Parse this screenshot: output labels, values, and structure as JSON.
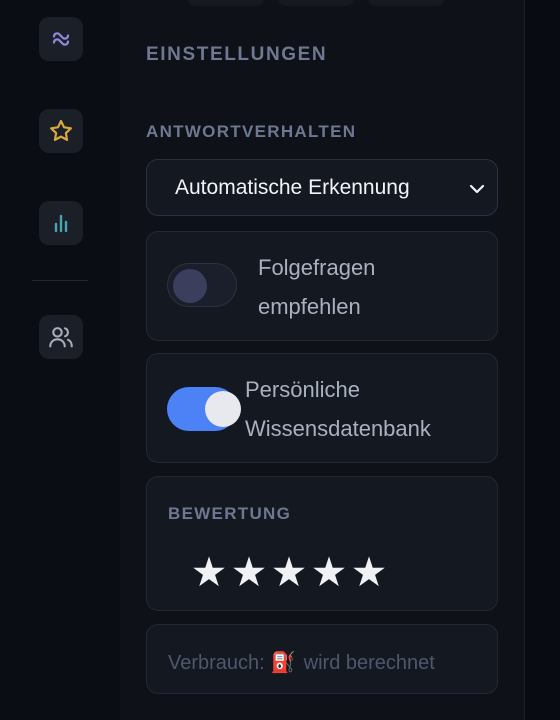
{
  "rail": {
    "items": [
      {
        "icon": "link-icon",
        "color": "#8f86d8"
      },
      {
        "icon": "star-icon",
        "color": "#d9a93c"
      },
      {
        "icon": "bar-chart-icon",
        "color": "#4aa3b0"
      },
      {
        "icon": "users-icon",
        "color": "#a7aebb"
      }
    ]
  },
  "settings": {
    "title": "EINSTELLUNGEN",
    "response_behavior": {
      "label": "ANTWORTVERHALTEN",
      "selected": "Automatische Erkennung"
    },
    "toggles": [
      {
        "label_line1": "Folgefragen",
        "label_line2": "empfehlen",
        "enabled": false
      },
      {
        "label_line1": "Persönliche",
        "label_line2": "Wissensdatenbank",
        "enabled": true
      }
    ],
    "rating": {
      "label": "BEWERTUNG",
      "stars": [
        "★",
        "★",
        "★",
        "★",
        "★"
      ],
      "value": 5,
      "max": 5
    },
    "usage": {
      "label": "Verbrauch:",
      "icon": "fuel-pump-icon",
      "icon_glyph": "⛽",
      "status": "wird berechnet"
    }
  },
  "colors": {
    "accent": "#4c82f5",
    "background": "#0e1118",
    "card": "#141821"
  }
}
